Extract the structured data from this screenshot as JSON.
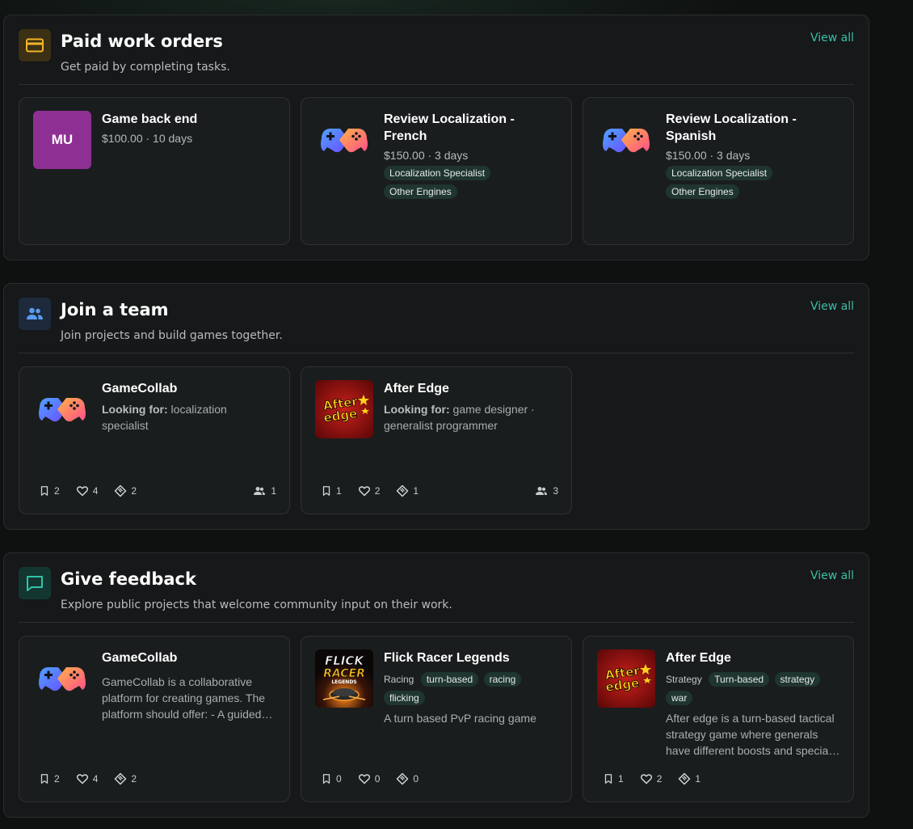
{
  "sections": {
    "paid": {
      "title": "Paid work orders",
      "subtitle": "Get paid by completing tasks.",
      "view_all": "View all",
      "icon": "credit-card-icon",
      "cards": [
        {
          "thumb_text": "MU",
          "title": "Game back end",
          "meta": "$100.00 · 10 days",
          "tags": []
        },
        {
          "thumb_icon": "gamecollab-logo",
          "title": "Review Localization - French",
          "meta": "$150.00 · 3 days",
          "tags": [
            "Localization Specialist",
            "Other Engines"
          ]
        },
        {
          "thumb_icon": "gamecollab-logo",
          "title": "Review Localization - Spanish",
          "meta": "$150.00 · 3 days",
          "tags": [
            "Localization Specialist",
            "Other Engines"
          ]
        }
      ]
    },
    "team": {
      "title": "Join a team",
      "subtitle": "Join projects and build games together.",
      "view_all": "View all",
      "icon": "people-icon",
      "looking_label": "Looking for:",
      "cards": [
        {
          "thumb_icon": "gamecollab-logo",
          "title": "GameCollab",
          "looking_for": "localization specialist",
          "bookmarks": "2",
          "likes": "4",
          "tags_count": "2",
          "members": "1"
        },
        {
          "thumb_icon": "after-edge-logo",
          "title": "After Edge",
          "looking_for": "game designer · generalist programmer",
          "bookmarks": "1",
          "likes": "2",
          "tags_count": "1",
          "members": "3"
        }
      ]
    },
    "feedback": {
      "title": "Give feedback",
      "subtitle": "Explore public projects that welcome community input on their work.",
      "view_all": "View all",
      "icon": "chat-bubble-icon",
      "cards": [
        {
          "thumb_icon": "gamecollab-logo",
          "title": "GameCollab",
          "genre": "",
          "tags": [],
          "description": "GameCollab is a collaborative platform for creating games. The platform should offer: - A guided…",
          "bookmarks": "2",
          "likes": "4",
          "tags_count": "2"
        },
        {
          "thumb_icon": "flick-racer-logo",
          "title": "Flick Racer Legends",
          "genre": "Racing",
          "tags": [
            "turn-based",
            "racing",
            "flicking"
          ],
          "description": "A turn based PvP racing game",
          "bookmarks": "0",
          "likes": "0",
          "tags_count": "0"
        },
        {
          "thumb_icon": "after-edge-logo",
          "title": "After Edge",
          "genre": "Strategy",
          "tags": [
            "Turn-based",
            "strategy",
            "war"
          ],
          "description": "After edge is a turn-based tactical strategy game where generals have different boosts and specia…",
          "bookmarks": "1",
          "likes": "2",
          "tags_count": "1"
        }
      ]
    }
  },
  "logos": {
    "flick_line1": "FLICK",
    "flick_line2": "RACER",
    "flick_line3": "LEGENDS",
    "after_line1": "After",
    "after_line2": "edge"
  },
  "colors": {
    "accent": "#3bbfa8",
    "tag_bg": "#1f3530",
    "mu_purple": "#8e2f93",
    "paid_icon": "#f0b429",
    "team_icon": "#5b9bf0",
    "feedback_icon": "#2fc4a8"
  }
}
